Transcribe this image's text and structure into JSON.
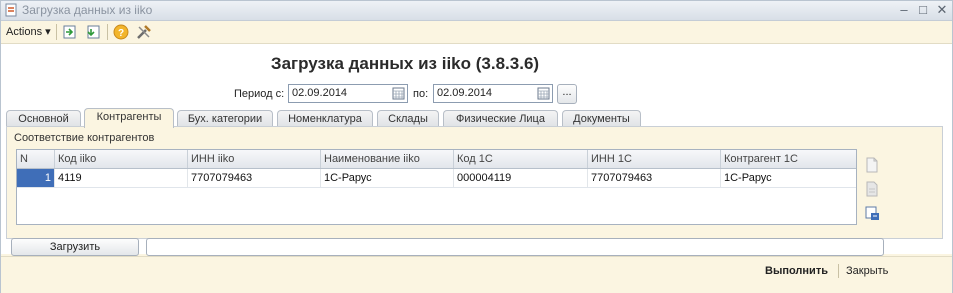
{
  "window": {
    "title": "Загрузка данных из iiko"
  },
  "toolbar": {
    "actions_label": "Actions ▾"
  },
  "form": {
    "title": "Загрузка данных из iiko (3.8.3.6)",
    "period_label": "Период с:",
    "date_from": "02.09.2014",
    "to_label": "по:",
    "date_to": "02.09.2014",
    "dots_label": "..."
  },
  "tabs": [
    {
      "label": "Основной"
    },
    {
      "label": "Контрагенты",
      "active": true
    },
    {
      "label": "Бух. категории"
    },
    {
      "label": "Номенклатура"
    },
    {
      "label": "Склады"
    },
    {
      "label": "Физические Лица"
    },
    {
      "label": "Документы"
    }
  ],
  "panel": {
    "section_label": "Соответствие контрагентов",
    "columns": [
      "N",
      "Код iiko",
      "ИНН iiko",
      "Наименование iiko",
      "Код 1С",
      "ИНН 1С",
      "Контрагент 1С"
    ],
    "rows": [
      [
        "1",
        "4119",
        "7707079463",
        "1С-Рарус",
        "000004119",
        "7707079463",
        "1С-Рарус"
      ]
    ]
  },
  "bottom": {
    "load_label": "Загрузить",
    "progress": 0
  },
  "footer": {
    "run_label": "Выполнить",
    "close_label": "Закрыть"
  },
  "colors": {
    "accent": "#3f6eb8",
    "panel_bg": "#fbf5e1"
  },
  "icons": [
    "form-icon",
    "minimize-icon",
    "maximize-icon",
    "close-icon",
    "import-icon",
    "export-icon",
    "help-icon",
    "tools-icon",
    "calendar-icon",
    "new-document-icon",
    "document-gray-icon",
    "save-document-icon"
  ]
}
